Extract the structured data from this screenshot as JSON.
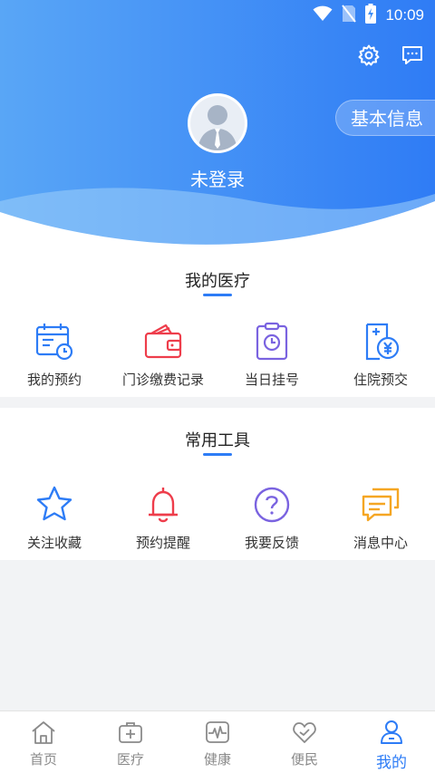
{
  "status_bar": {
    "time": "10:09",
    "icons": [
      "wifi-icon",
      "no-sim-icon",
      "battery-charging-icon"
    ]
  },
  "header": {
    "settings_icon": "gear-icon",
    "message_icon": "chat-icon",
    "login_status": "未登录",
    "basic_info": "基本信息",
    "accent_color": "#2d7cf6"
  },
  "my_medical": {
    "title": "我的医疗",
    "items": [
      {
        "label": "我的预约",
        "icon": "calendar-clock-icon"
      },
      {
        "label": "门诊缴费记录",
        "icon": "wallet-icon"
      },
      {
        "label": "当日挂号",
        "icon": "clipboard-clock-icon"
      },
      {
        "label": "住院预交",
        "icon": "document-yuan-icon"
      }
    ]
  },
  "tools": {
    "title": "常用工具",
    "items": [
      {
        "label": "关注收藏",
        "icon": "star-icon"
      },
      {
        "label": "预约提醒",
        "icon": "bell-icon"
      },
      {
        "label": "我要反馈",
        "icon": "question-icon"
      },
      {
        "label": "消息中心",
        "icon": "messages-icon"
      }
    ]
  },
  "tabbar": {
    "active": "我的",
    "items": [
      {
        "label": "首页",
        "icon": "home-icon"
      },
      {
        "label": "医疗",
        "icon": "medical-kit-icon"
      },
      {
        "label": "健康",
        "icon": "heartbeat-icon"
      },
      {
        "label": "便民",
        "icon": "heart-hand-icon"
      },
      {
        "label": "我的",
        "icon": "user-icon"
      }
    ]
  }
}
